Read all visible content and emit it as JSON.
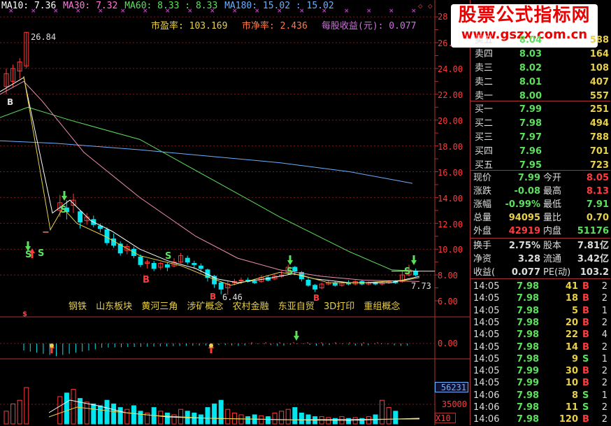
{
  "ma_bar": {
    "ma10": "MA10: 7.36",
    "ma30": "MA30: 7.32",
    "ma60": "MA60: 8.33 : 8.33",
    "ma180": "MA180: 15.02 : 15.02"
  },
  "colors": {
    "up": "#ff3b3b",
    "down": "#00e5ee",
    "green": "#5ce05c",
    "yellow": "#e8d048",
    "ma10": "#ffffff",
    "ma30": "#e8d048",
    "ma60": "#5ce05c",
    "ma180": "#6ab0ff",
    "pink": "#f08fb0"
  },
  "indicators": {
    "pe": "市盈率: 103.169",
    "pb": "市净率: 2.436",
    "eps": "每股收益(元): 0.077"
  },
  "labels": {
    "peak": "26.84",
    "low": "6.46",
    "last": "7.73",
    "signal_b": "B",
    "signal_s": "S"
  },
  "concepts": [
    "钢铁",
    "山东板块",
    "黄河三角",
    "涉矿概念",
    "农村金融",
    "东亚自贸",
    "3D打印",
    "重组概念"
  ],
  "price_axis": [
    "26.00",
    "24.00",
    "22.00",
    "20.00",
    "18.00",
    "16.00",
    "14.00",
    "12.00",
    "10.00",
    "8.00",
    "6.00"
  ],
  "price_axis_top": "28",
  "macd_axis": "0.00",
  "volume": {
    "current": "56231",
    "mid": "35000",
    "unit": "X10"
  },
  "logo": {
    "line1": "股票公式指标网",
    "line2": "www.gszx.com.cn"
  },
  "order_book": {
    "asks": [
      {
        "label": "卖五",
        "price": "8.04",
        "vol": "588"
      },
      {
        "label": "卖四",
        "price": "8.03",
        "vol": "164"
      },
      {
        "label": "卖三",
        "price": "8.02",
        "vol": "108"
      },
      {
        "label": "卖二",
        "price": "8.01",
        "vol": "407"
      },
      {
        "label": "卖一",
        "price": "8.00",
        "vol": "557"
      }
    ],
    "bids": [
      {
        "label": "买一",
        "price": "7.99",
        "vol": "251"
      },
      {
        "label": "买二",
        "price": "7.98",
        "vol": "494"
      },
      {
        "label": "买三",
        "price": "7.97",
        "vol": "788"
      },
      {
        "label": "买四",
        "price": "7.96",
        "vol": "701"
      },
      {
        "label": "买五",
        "price": "7.95",
        "vol": "723"
      }
    ]
  },
  "stats": [
    {
      "l1": "现价",
      "v1": "7.99",
      "c1": "#5ce05c",
      "l2": "今开",
      "v2": "8.05",
      "c2": "#ff3b3b"
    },
    {
      "l1": "涨跌",
      "v1": "-0.08",
      "c1": "#5ce05c",
      "l2": "最高",
      "v2": "8.13",
      "c2": "#ff3b3b"
    },
    {
      "l1": "涨幅",
      "v1": "-0.99%",
      "c1": "#5ce05c",
      "l2": "最低",
      "v2": "7.91",
      "c2": "#5ce05c"
    },
    {
      "l1": "总量",
      "v1": "94095",
      "c1": "#e8d048",
      "l2": "量比",
      "v2": "0.70",
      "c2": "#e8d048"
    },
    {
      "l1": "外盘",
      "v1": "42919",
      "c1": "#ff3b3b",
      "l2": "内盘",
      "v2": "51176",
      "c2": "#5ce05c"
    }
  ],
  "stats2": [
    {
      "l1": "换手",
      "v1": "2.75%",
      "c1": "#ddd",
      "l2": "股本",
      "v2": "7.81亿",
      "c2": "#ddd"
    },
    {
      "l1": "净资",
      "v1": "3.28",
      "c1": "#ddd",
      "l2": "流通",
      "v2": "3.42亿",
      "c2": "#ddd"
    },
    {
      "l1": "收益(",
      "v1": "0.077",
      "c1": "#ddd",
      "l2": "PE(动)",
      "v2": "103.2",
      "c2": "#ddd"
    }
  ],
  "ticks": [
    {
      "time": "14:05",
      "price": "7.98",
      "vol": "41",
      "bs": "B",
      "count": "2"
    },
    {
      "time": "14:05",
      "price": "7.98",
      "vol": "18",
      "bs": "B",
      "count": "2"
    },
    {
      "time": "14:05",
      "price": "7.98",
      "vol": "5",
      "bs": "B",
      "count": "1"
    },
    {
      "time": "14:05",
      "price": "7.98",
      "vol": "20",
      "bs": "B",
      "count": "2"
    },
    {
      "time": "14:05",
      "price": "7.98",
      "vol": "22",
      "bs": "B",
      "count": "4"
    },
    {
      "time": "14:05",
      "price": "7.98",
      "vol": "14",
      "bs": "B",
      "count": "2"
    },
    {
      "time": "14:05",
      "price": "7.98",
      "vol": "9",
      "bs": "S",
      "count": "1"
    },
    {
      "time": "14:05",
      "price": "7.99",
      "vol": "30",
      "bs": "B",
      "count": "2"
    },
    {
      "time": "14:05",
      "price": "7.99",
      "vol": "10",
      "bs": "B",
      "count": "2"
    },
    {
      "time": "14:06",
      "price": "7.98",
      "vol": "8",
      "bs": "S",
      "count": "1"
    },
    {
      "time": "14:06",
      "price": "7.98",
      "vol": "11",
      "bs": "S",
      "count": "2"
    },
    {
      "time": "14:06",
      "price": "7.98",
      "vol": "120",
      "bs": "B",
      "count": "2"
    }
  ]
}
